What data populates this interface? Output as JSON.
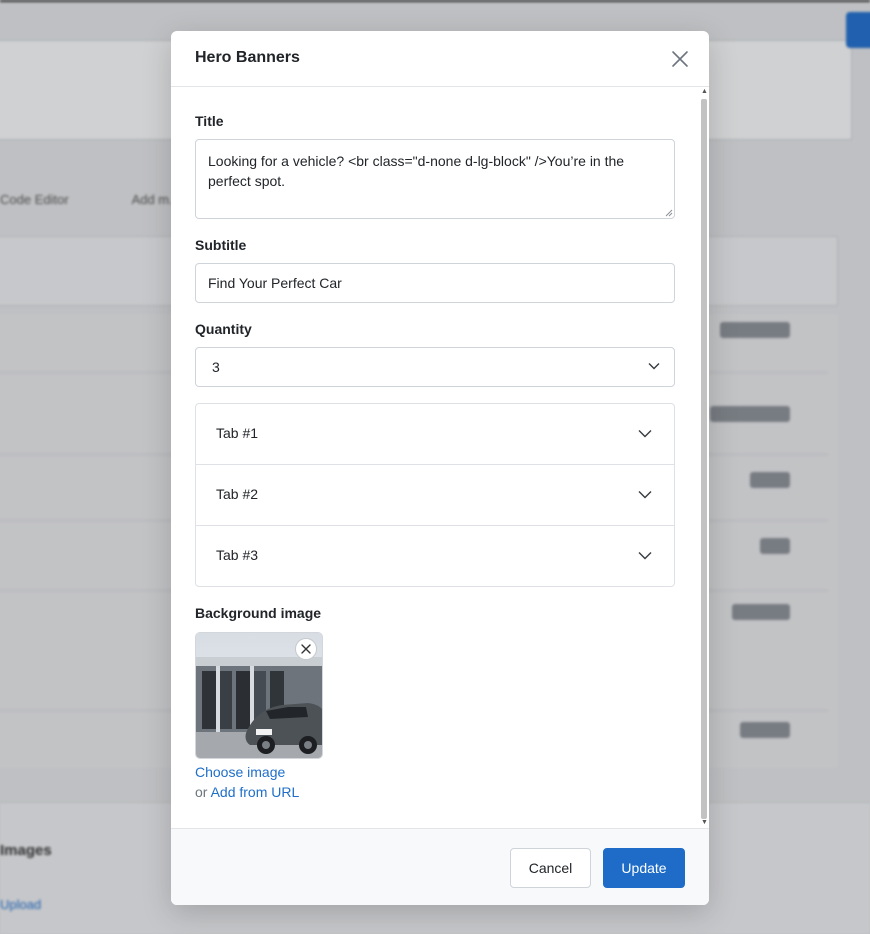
{
  "background": {
    "tabs": [
      "Code Editor",
      "Add m..."
    ],
    "section_title": "Images",
    "link": "Upload"
  },
  "modal": {
    "title": "Hero Banners",
    "fields": {
      "title_label": "Title",
      "title_value": "Looking for a vehicle? <br class=\"d-none d-lg-block\" />You’re in the perfect spot.",
      "subtitle_label": "Subtitle",
      "subtitle_value": "Find Your Perfect Car",
      "quantity_label": "Quantity",
      "quantity_value": "3"
    },
    "accordion": [
      {
        "label": "Tab #1"
      },
      {
        "label": "Tab #2"
      },
      {
        "label": "Tab #3"
      }
    ],
    "background_image": {
      "label": "Background image",
      "choose_link": "Choose image",
      "or_text": "or",
      "url_link": "Add from URL",
      "plate_text": "CAR 001"
    },
    "footer": {
      "cancel_label": "Cancel",
      "update_label": "Update"
    }
  },
  "colors": {
    "primary": "#1e6cc8",
    "link": "#1f6fc8",
    "border": "#ced4da"
  }
}
